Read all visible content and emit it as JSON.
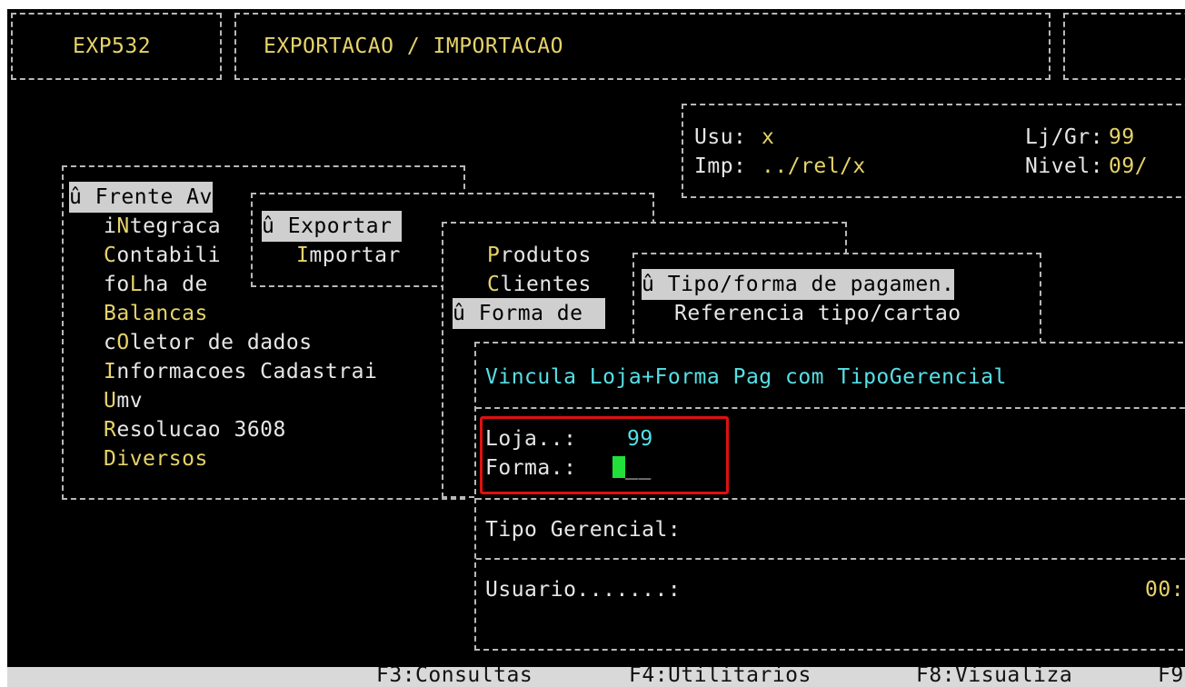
{
  "header": {
    "program_code": "EXP532",
    "program_title": "EXPORTACAO / IMPORTACAO"
  },
  "session": {
    "user_label": "Usu:",
    "user_value": "x",
    "printer_label": "Imp:",
    "printer_value": "../rel/x",
    "store_group_label": "Lj/Gr:",
    "store_group_value": "99",
    "level_label": "Nivel:",
    "level_value": "09/"
  },
  "main_menu": {
    "marker": "û",
    "items": [
      {
        "pre": "",
        "hot": "",
        "rest": "Frente Av"
      },
      {
        "pre": "i",
        "hot": "N",
        "rest": "tegraca"
      },
      {
        "pre": "",
        "hot": "C",
        "rest": "ontabili"
      },
      {
        "pre": "fo",
        "hot": "L",
        "rest": "ha de"
      },
      {
        "pre": "",
        "hot": "B",
        "rest": "alancas"
      },
      {
        "pre": "c",
        "hot": "O",
        "rest": "letor de dados"
      },
      {
        "pre": "",
        "hot": "I",
        "rest": "nformacoes Cadastrai"
      },
      {
        "pre": "",
        "hot": "U",
        "rest": "mv"
      },
      {
        "pre": "",
        "hot": "R",
        "rest": "esolucao 3608"
      },
      {
        "pre": "",
        "hot": "D",
        "rest": "iversos"
      }
    ]
  },
  "submenu_exp_imp": {
    "items": [
      {
        "pre": "",
        "hot": "",
        "rest": "Exportar"
      },
      {
        "pre": "",
        "hot": "I",
        "rest": "mportar"
      }
    ]
  },
  "submenu_tables": {
    "items": [
      {
        "pre": "",
        "hot": "P",
        "rest": "rodutos"
      },
      {
        "pre": "",
        "hot": "C",
        "rest": "lientes"
      },
      {
        "pre": "",
        "hot": "",
        "rest": "Forma de"
      }
    ]
  },
  "submenu_payment": {
    "items": [
      {
        "pre": "",
        "hot": "",
        "rest": "Tipo/forma de pagamen."
      },
      {
        "pre": "",
        "hot": "R",
        "rest": "eferencia tipo/cartao"
      }
    ]
  },
  "dialog": {
    "title": "Vincula Loja+Forma Pag com TipoGerencial",
    "store_label": "Loja..:",
    "store_value": "99",
    "form_label": "Forma.:",
    "form_placeholder": "__",
    "type_label": "Tipo Gerencial:",
    "user_label": "Usuario.......:",
    "user_value": "00:"
  },
  "function_keys": {
    "f3": "F3:Consultas",
    "f4": "F4:Utilitarios",
    "f8": "F8:Visualiza",
    "f9": "F9"
  },
  "colors": {
    "background": "#000000",
    "text": "#e6e6e6",
    "highlight_yellow": "#e6d36a",
    "value_cyan": "#55e0e6",
    "cursor_green": "#22e03a",
    "selection_bg": "#cfcfcf",
    "annotation_red": "#e01010"
  }
}
